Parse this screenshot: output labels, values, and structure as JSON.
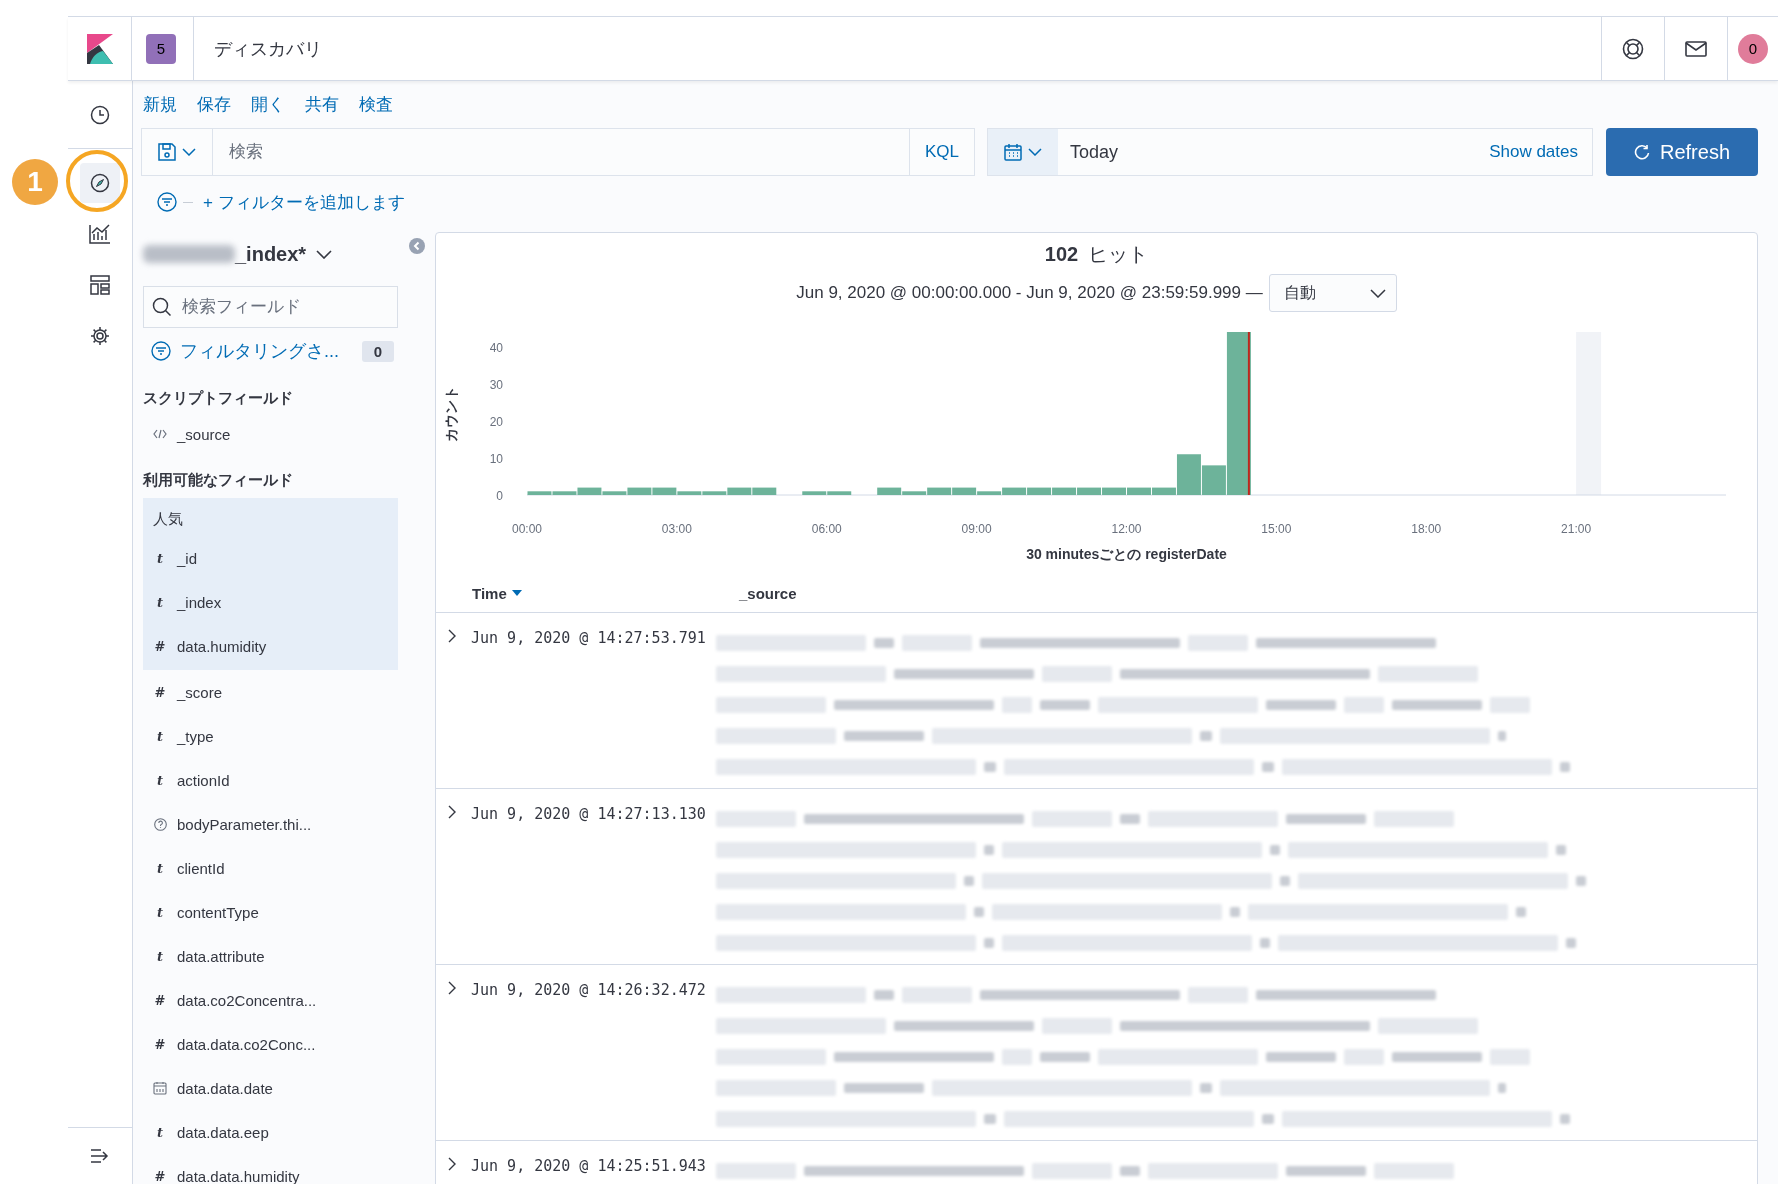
{
  "header": {
    "space_badge": "5",
    "title": "ディスカバリ",
    "avatar": "0"
  },
  "callout": {
    "label": "1"
  },
  "nav": [
    {
      "kind": "clock",
      "selected": false,
      "highlighted": false
    },
    {
      "kind": "compass",
      "selected": true,
      "highlighted": true
    },
    {
      "kind": "chart",
      "selected": false,
      "highlighted": false
    },
    {
      "kind": "dashboard",
      "selected": false,
      "highlighted": false
    },
    {
      "kind": "gear",
      "selected": false,
      "highlighted": false
    }
  ],
  "top_menu": [
    "新規",
    "保存",
    "開く",
    "共有",
    "検査"
  ],
  "query": {
    "placeholder": "検索",
    "language": "KQL"
  },
  "date_picker": {
    "value": "Today",
    "show_dates": "Show dates"
  },
  "refresh_button": "Refresh",
  "filter_bar": {
    "add_filter": "+ フィルターを追加します"
  },
  "sidebar": {
    "index_pattern": "_index*",
    "search_placeholder": "検索フィールド",
    "filter_label": "フィルタリングさ...",
    "filter_count": "0",
    "scripted": {
      "title": "スクリプトフィールド",
      "fields": [
        {
          "kind": "source",
          "name": "_source"
        }
      ]
    },
    "available": {
      "title": "利用可能なフィールド",
      "popular_title": "人気",
      "popular": [
        {
          "kind": "string",
          "glyph": "t",
          "name": "_id"
        },
        {
          "kind": "string",
          "glyph": "t",
          "name": "_index"
        },
        {
          "kind": "number",
          "glyph": "#",
          "name": "data.humidity"
        }
      ],
      "fields": [
        {
          "kind": "number",
          "glyph": "#",
          "name": "_score"
        },
        {
          "kind": "string",
          "glyph": "t",
          "name": "_type"
        },
        {
          "kind": "string",
          "glyph": "t",
          "name": "actionId"
        },
        {
          "kind": "unknown",
          "name": "bodyParameter.thi..."
        },
        {
          "kind": "string",
          "glyph": "t",
          "name": "clientId"
        },
        {
          "kind": "string",
          "glyph": "t",
          "name": "contentType"
        },
        {
          "kind": "string",
          "glyph": "t",
          "name": "data.attribute"
        },
        {
          "kind": "number",
          "glyph": "#",
          "name": "data.co2Concentra..."
        },
        {
          "kind": "number",
          "glyph": "#",
          "name": "data.data.co2Conc..."
        },
        {
          "kind": "date",
          "name": "data.data.date"
        },
        {
          "kind": "string",
          "glyph": "t",
          "name": "data.data.eep"
        },
        {
          "kind": "number",
          "glyph": "#",
          "name": "data.data.humidity"
        }
      ]
    }
  },
  "results": {
    "hits": "102",
    "hits_label": "ヒット",
    "range": "Jun 9, 2020 @ 00:00:00.000 - Jun 9, 2020 @ 23:59:59.999 —",
    "interval": "自動",
    "chart_data": {
      "type": "bar",
      "xlabel": "30 minutesごとの registerDate",
      "ylabel": "カウント",
      "x": [
        0.25,
        0.75,
        1.25,
        1.75,
        2.25,
        2.75,
        3.25,
        3.75,
        4.25,
        4.75,
        5.25,
        5.75,
        6.25,
        6.75,
        7.25,
        7.75,
        8.25,
        8.75,
        9.25,
        9.75,
        10.25,
        10.75,
        11.25,
        11.75,
        12.25,
        12.75,
        13.25,
        13.75,
        14.25,
        14.75,
        15.25,
        15.75,
        16.25,
        16.75,
        17.25,
        17.75,
        18.25,
        18.75,
        19.25,
        19.75,
        20.25,
        20.75,
        21.25,
        21.75,
        22.25,
        22.75,
        23.25,
        23.75
      ],
      "series": [
        {
          "color": "#6db39a",
          "values": [
            1,
            1,
            2,
            1,
            2,
            2,
            1,
            1,
            2,
            2,
            0,
            1,
            1,
            0,
            2,
            1,
            2,
            2,
            1,
            2,
            2,
            2,
            2,
            2,
            2,
            2,
            11,
            8,
            44,
            0,
            0,
            0,
            0,
            0,
            0,
            0,
            0,
            0,
            0,
            0,
            0,
            0,
            0,
            0,
            0,
            0,
            0,
            0
          ]
        }
      ],
      "xlim": [
        0,
        24
      ],
      "ylim": [
        0,
        44
      ],
      "xticks": [
        {
          "value": 0,
          "label": "00:00"
        },
        {
          "value": 3,
          "label": "03:00"
        },
        {
          "value": 6,
          "label": "06:00"
        },
        {
          "value": 9,
          "label": "09:00"
        },
        {
          "value": 12,
          "label": "12:00"
        },
        {
          "value": 15,
          "label": "15:00"
        },
        {
          "value": 18,
          "label": "18:00"
        },
        {
          "value": 21,
          "label": "21:00"
        }
      ],
      "yticks": [
        0,
        10,
        20,
        30,
        40
      ]
    },
    "columns": [
      {
        "label": "Time",
        "sorted": true
      },
      {
        "label": "_source",
        "sorted": false
      }
    ],
    "rows": [
      {
        "time": "Jun 9, 2020 @ 14:27:53.791",
        "expanded": false
      },
      {
        "time": "Jun 9, 2020 @ 14:27:13.130",
        "expanded": false
      },
      {
        "time": "Jun 9, 2020 @ 14:26:32.472",
        "expanded": false
      },
      {
        "time": "Jun 9, 2020 @ 14:25:51.943",
        "expanded": false
      }
    ]
  }
}
